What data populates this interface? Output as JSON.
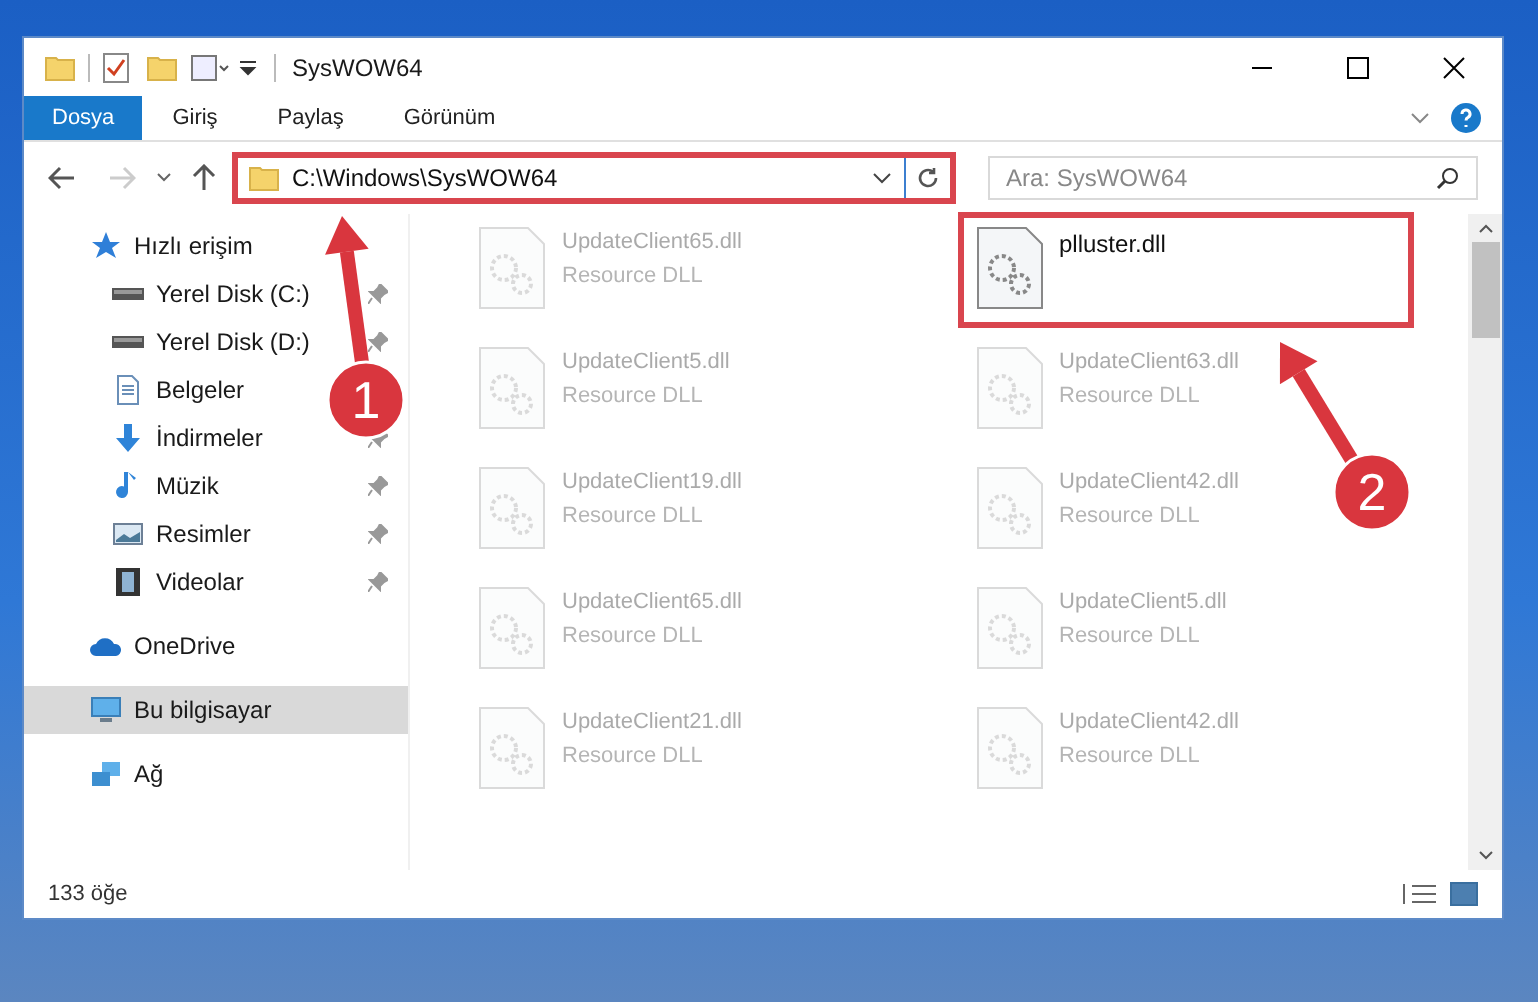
{
  "window": {
    "title": "SysWOW64"
  },
  "ribbon_tabs": [
    {
      "label": "Dosya",
      "kind": "file"
    },
    {
      "label": "Giriş",
      "kind": "tab"
    },
    {
      "label": "Paylaş",
      "kind": "tab"
    },
    {
      "label": "Görünüm",
      "kind": "tab"
    }
  ],
  "address_bar": {
    "path": "C:\\Windows\\SysWOW64",
    "highlighted": true
  },
  "search": {
    "placeholder": "Ara: SysWOW64"
  },
  "sidebar": {
    "items": [
      {
        "label": "Hızlı erişim",
        "kind": "star",
        "selected": false,
        "children": [
          {
            "label": "Yerel Disk (C:)",
            "kind": "drive",
            "pinned": true,
            "selected": false
          },
          {
            "label": "Yerel Disk (D:)",
            "kind": "drive",
            "pinned": true,
            "selected": false
          },
          {
            "label": "Belgeler",
            "kind": "doc",
            "pinned": false,
            "selected": false
          },
          {
            "label": "İndirmeler",
            "kind": "down",
            "pinned": true,
            "selected": false
          },
          {
            "label": "Müzik",
            "kind": "music",
            "pinned": true,
            "selected": false
          },
          {
            "label": "Resimler",
            "kind": "image",
            "pinned": true,
            "selected": false
          },
          {
            "label": "Videolar",
            "kind": "film",
            "pinned": true,
            "selected": false
          }
        ]
      },
      {
        "label": "OneDrive",
        "kind": "cloud",
        "selected": false
      },
      {
        "label": "Bu bilgisayar",
        "kind": "pc",
        "selected": true
      },
      {
        "label": "Ağ",
        "kind": "net",
        "selected": false
      }
    ]
  },
  "files": [
    {
      "name": "UpdateClient65.dll",
      "type": "Resource DLL",
      "highlighted": false
    },
    {
      "name": "plluster.dll",
      "highlighted": true
    },
    {
      "name": "UpdateClient5.dll",
      "type": "Resource DLL",
      "highlighted": false
    },
    {
      "name": "UpdateClient63.dll",
      "type": "Resource DLL",
      "highlighted": false
    },
    {
      "name": "UpdateClient19.dll",
      "type": "Resource DLL",
      "highlighted": false
    },
    {
      "name": "UpdateClient42.dll",
      "type": "Resource DLL",
      "highlighted": false
    },
    {
      "name": "UpdateClient65.dll",
      "type": "Resource DLL",
      "highlighted": false
    },
    {
      "name": "UpdateClient5.dll",
      "type": "Resource DLL",
      "highlighted": false
    },
    {
      "name": "UpdateClient21.dll",
      "type": "Resource DLL",
      "highlighted": false
    },
    {
      "name": "UpdateClient42.dll",
      "type": "Resource DLL",
      "highlighted": false
    }
  ],
  "status_bar": {
    "count": "133 öğe"
  },
  "annotations": [
    {
      "label": "1"
    },
    {
      "label": "2"
    }
  ]
}
